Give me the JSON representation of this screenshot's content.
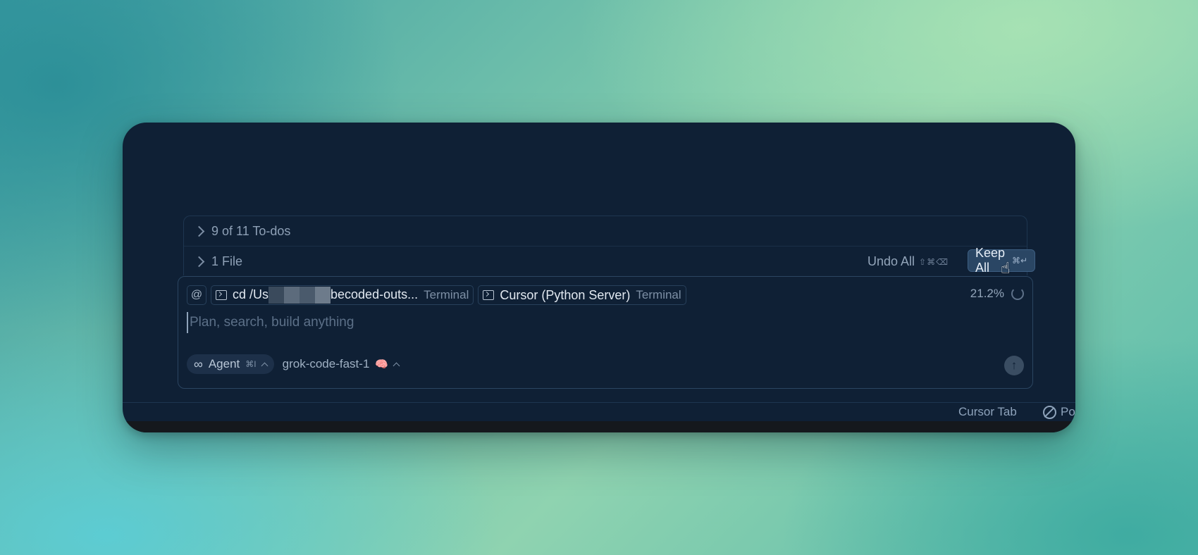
{
  "panel": {
    "todos_label": "9 of 11 To-dos",
    "files_label": "1 File",
    "undo_all_label": "Undo All",
    "undo_all_shortcut": "⇧⌘⌫",
    "keep_all_label": "Keep All",
    "keep_all_shortcut": "⌘↵"
  },
  "composer": {
    "at_symbol": "@",
    "chips": [
      {
        "label": "cd /Us",
        "label_tail": "becoded-outs...",
        "sublabel": "Terminal",
        "icon": "terminal-icon"
      },
      {
        "label": "Cursor (Python Server)",
        "sublabel": "Terminal",
        "icon": "terminal-icon"
      }
    ],
    "context_percent": "21.2%",
    "input_placeholder": "Plan, search, build anything",
    "agent_label": "Agent",
    "agent_shortcut": "⌘I",
    "model_label": "grok-code-fast-1"
  },
  "statusbar": {
    "cursor_tab_label": "Cursor Tab",
    "po_label": "Po"
  },
  "colors": {
    "window_bg": "#0f2035",
    "keep_all_bg": "#2a4664",
    "arrow": "#ffffff"
  }
}
